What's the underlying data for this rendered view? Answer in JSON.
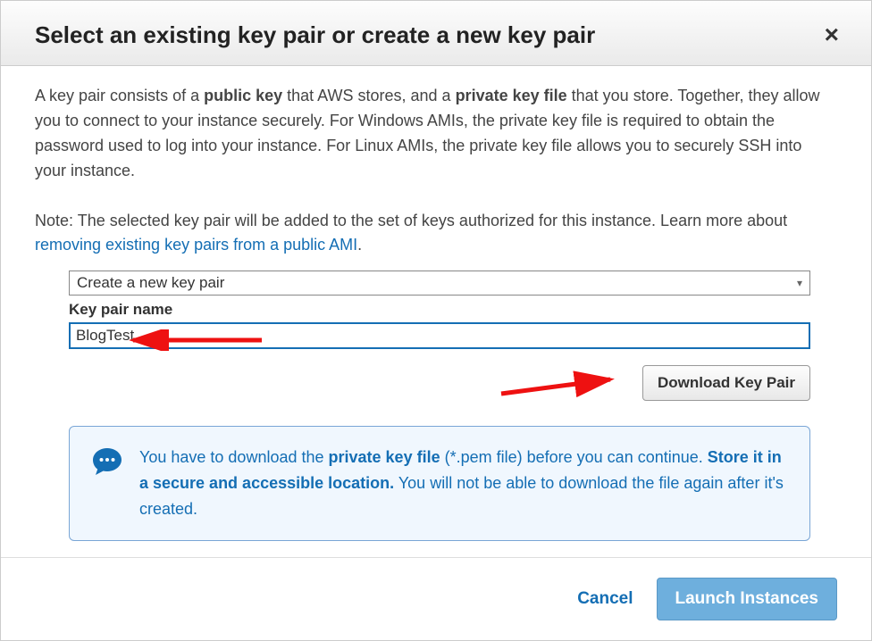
{
  "header": {
    "title": "Select an existing key pair or create a new key pair",
    "close_label": "×"
  },
  "description": {
    "pre1": "A key pair consists of a ",
    "bold1": "public key",
    "mid1": " that AWS stores, and a ",
    "bold2": "private key file",
    "post1": " that you store. Together, they allow you to connect to your instance securely. For Windows AMIs, the private key file is required to obtain the password used to log into your instance. For Linux AMIs, the private key file allows you to securely SSH into your instance."
  },
  "note": {
    "text": "Note: The selected key pair will be added to the set of keys authorized for this instance. Learn more about ",
    "link_text": "removing existing key pairs from a public AMI",
    "dot": "."
  },
  "form": {
    "select_value": "Create a new key pair",
    "keypair_label": "Key pair name",
    "keypair_value": "BlogTest",
    "download_label": "Download Key Pair"
  },
  "info": {
    "pre": "You have to download the ",
    "bold1": "private key file",
    "mid": " (*.pem file) before you can continue. ",
    "bold2": "Store it in a secure and accessible location.",
    "post": " You will not be able to download the file again after it's created."
  },
  "footer": {
    "cancel": "Cancel",
    "launch": "Launch Instances"
  }
}
